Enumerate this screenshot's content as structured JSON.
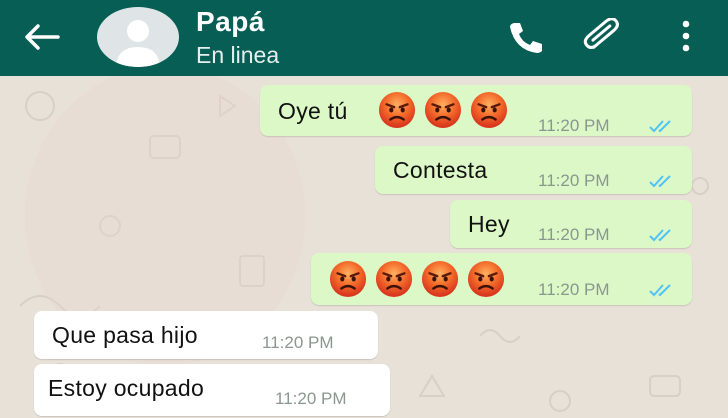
{
  "header": {
    "contact_name": "Papá",
    "status": "En linea",
    "icons": [
      "back-arrow-icon",
      "avatar-placeholder-icon",
      "phone-icon",
      "paperclip-icon",
      "more-vert-icon"
    ]
  },
  "messages": [
    {
      "direction": "outgoing",
      "text": "Oye tú",
      "emojis": [
        "angry-face",
        "angry-face",
        "angry-face"
      ],
      "time": "11:20 PM",
      "status": "read"
    },
    {
      "direction": "outgoing",
      "text": "Contesta",
      "time": "11:20 PM",
      "status": "read"
    },
    {
      "direction": "outgoing",
      "text": "Hey",
      "time": "11:20 PM",
      "status": "read"
    },
    {
      "direction": "outgoing",
      "text": "",
      "emojis": [
        "angry-face",
        "angry-face",
        "angry-face",
        "angry-face"
      ],
      "time": "11:20 PM",
      "status": "read"
    },
    {
      "direction": "incoming",
      "text": "Que pasa hijo",
      "time": "11:20 PM"
    },
    {
      "direction": "incoming",
      "text": "Estoy ocupado",
      "time": "11:20 PM"
    }
  ],
  "colors": {
    "header_bg": "#075e54",
    "outgoing_bubble": "#dcf8c6",
    "incoming_bubble": "#ffffff",
    "read_tick": "#4fc3f7",
    "chat_bg": "#e7e1d8"
  }
}
